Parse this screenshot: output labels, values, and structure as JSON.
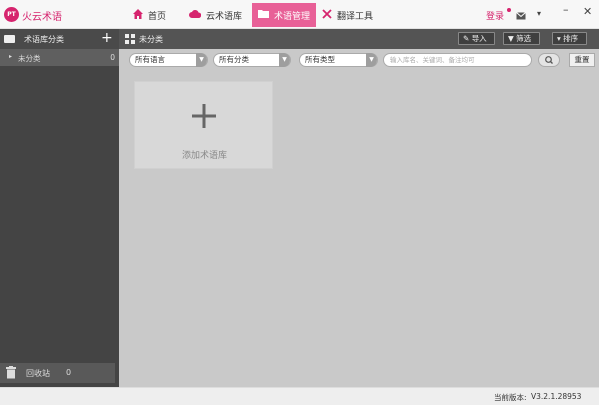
{
  "app": {
    "logo_text": "PT",
    "name": "火云术语",
    "brand_color": "#d6246e",
    "active_tab_color": "#e86097"
  },
  "nav": {
    "tabs": [
      {
        "label": "首页",
        "icon": "home-icon"
      },
      {
        "label": "云术语库",
        "icon": "cloud-icon"
      },
      {
        "label": "术语管理",
        "icon": "folder-icon",
        "active": true
      },
      {
        "label": "翻译工具",
        "icon": "tools-icon"
      }
    ]
  },
  "header_right": {
    "login": "登录",
    "window": {
      "minimize": "–",
      "close": "✕"
    }
  },
  "sidebar": {
    "title": "术语库分类",
    "items": [
      {
        "label": "未分类",
        "count": "0"
      }
    ],
    "recycle": {
      "label": "回收站",
      "count": "0"
    }
  },
  "main": {
    "title": "未分类",
    "buttons": {
      "import": "导入",
      "filter": "筛选",
      "sort": "排序"
    },
    "filters": {
      "language": "所有语言",
      "category": "所有分类",
      "type": "所有类型",
      "search_placeholder": "输入库名、关键词、备注均可",
      "reset": "重置"
    },
    "add_card": {
      "label": "添加术语库"
    }
  },
  "status": {
    "version_label": "当前版本:",
    "version_value": "V3.2.1.28953"
  }
}
